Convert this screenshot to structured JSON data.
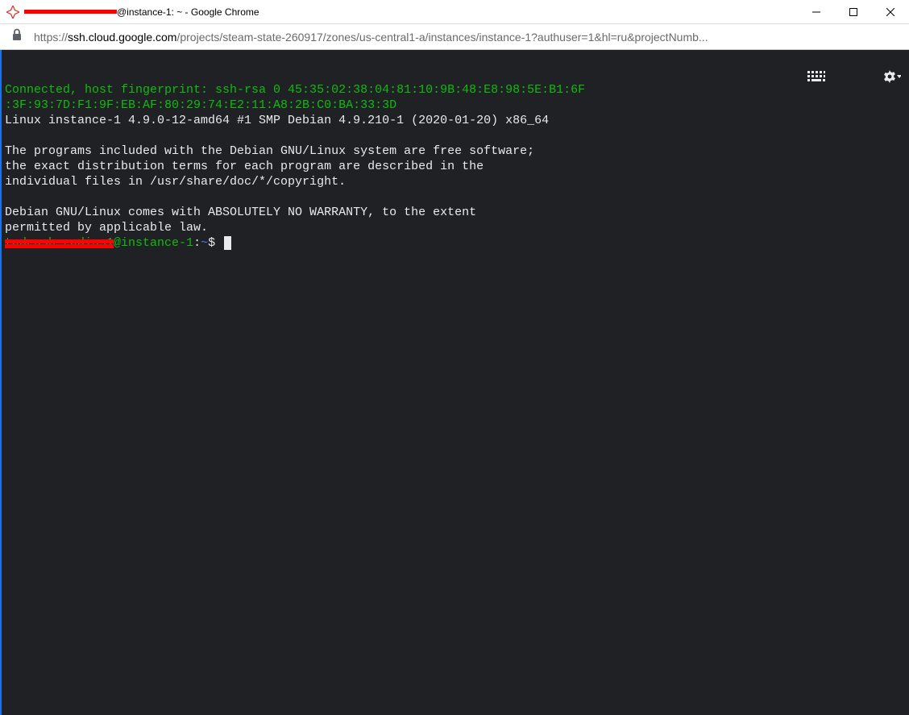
{
  "window": {
    "title_suffix": "@instance-1: ~ - Google Chrome"
  },
  "address": {
    "scheme": "https://",
    "host": "ssh.cloud.google.com",
    "path": "/projects/steam-state-260917/zones/us-central1-a/instances/instance-1?authuser=1&hl=ru&projectNumb..."
  },
  "terminal": {
    "line1": "Connected, host fingerprint: ssh-rsa 0 45:35:02:38:04:81:10:9B:48:E8:98:5E:B1:6F",
    "line2": ":3F:93:7D:F1:9F:EB:AF:80:29:74:E2:11:A8:2B:C0:BA:33:3D",
    "line3": "Linux instance-1 4.9.0-12-amd64 #1 SMP Debian 4.9.210-1 (2020-01-20) x86_64",
    "line4": "",
    "line5": "The programs included with the Debian GNU/Linux system are free software;",
    "line6": "the exact distribution terms for each program are described in the",
    "line7": "individual files in /usr/share/doc/*/copyright.",
    "line8": "",
    "line9": "Debian GNU/Linux comes with ABSOLUTELY NO WARRANTY, to the extent",
    "line10": "permitted by applicable law.",
    "prompt_user_hidden": "tadeush_radius1",
    "prompt_host": "@instance-1",
    "prompt_sep": ":",
    "prompt_path": "~",
    "prompt_end": "$ "
  }
}
